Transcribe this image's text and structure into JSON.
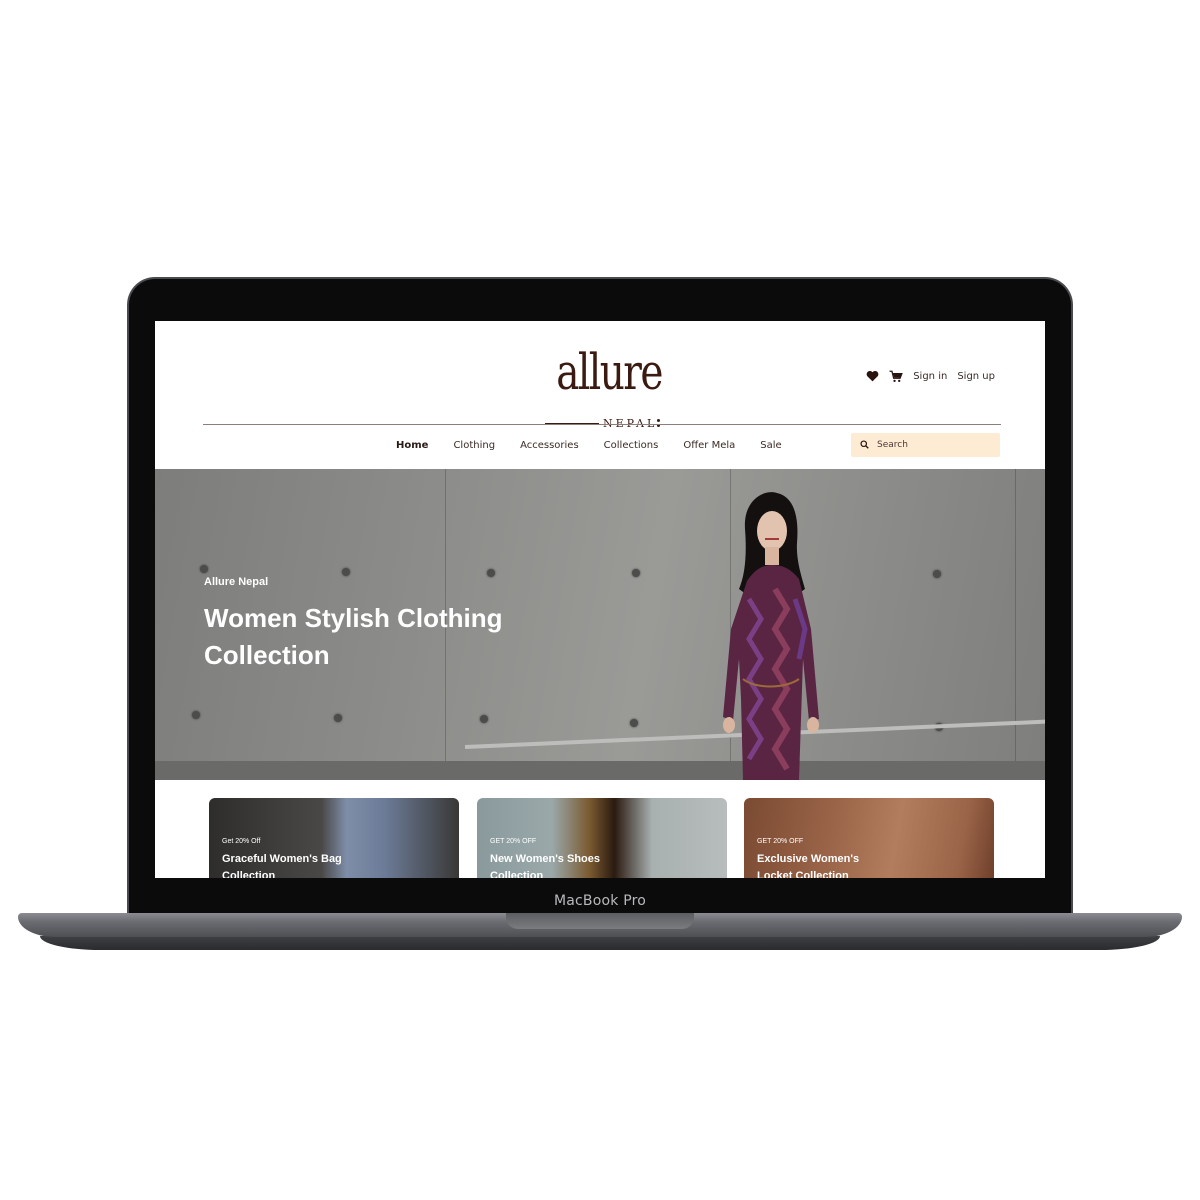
{
  "device": {
    "label": "MacBook Pro"
  },
  "site": {
    "logo": {
      "word": "allure",
      "sub": "NEPAL"
    },
    "header": {
      "sign_in": "Sign in",
      "sign_up": "Sign up"
    },
    "nav": {
      "items": [
        {
          "label": "Home",
          "active": true
        },
        {
          "label": "Clothing"
        },
        {
          "label": "Accessories"
        },
        {
          "label": "Collections"
        },
        {
          "label": "Offer Mela"
        },
        {
          "label": "Sale"
        }
      ]
    },
    "search": {
      "placeholder": "Search"
    },
    "hero": {
      "kicker": "Allure Nepal",
      "title": "Women Stylish Clothing Collection"
    },
    "cards": [
      {
        "offer": "Get 20% Off",
        "title": "Graceful Women's Bag Collection"
      },
      {
        "offer": "GET 20% OFF",
        "title": "New Women's Shoes Collection"
      },
      {
        "offer": "GET 20% OFF",
        "title": "Exclusive Women's Locket Collection"
      }
    ]
  },
  "colors": {
    "brand": "#3b1a12",
    "search_bg": "#fdebd3",
    "laptop_bezel": "#0b0b0c"
  }
}
